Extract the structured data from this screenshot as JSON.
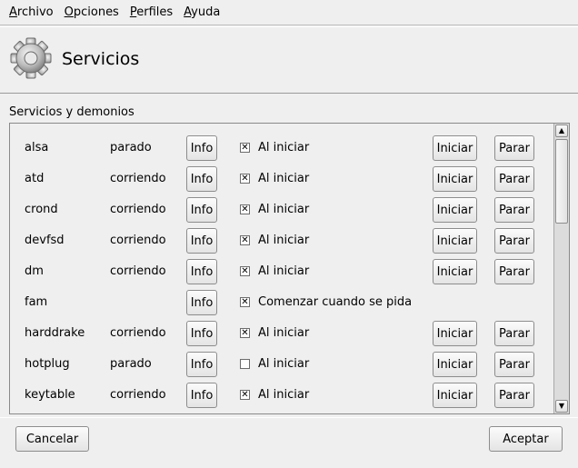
{
  "menubar": {
    "items": [
      {
        "first": "A",
        "rest": "rchivo"
      },
      {
        "first": "O",
        "rest": "pciones"
      },
      {
        "first": "P",
        "rest": "erfiles"
      },
      {
        "first": "A",
        "rest": "yuda"
      }
    ]
  },
  "header": {
    "title": "Servicios",
    "icon": "gear-icon"
  },
  "section_label": "Servicios y demonios",
  "services": [
    {
      "name": "alsa",
      "state": "parado",
      "info": "Info",
      "checked": true,
      "startup": "Al iniciar",
      "start": "Iniciar",
      "stop": "Parar"
    },
    {
      "name": "atd",
      "state": "corriendo",
      "info": "Info",
      "checked": true,
      "startup": "Al iniciar",
      "start": "Iniciar",
      "stop": "Parar"
    },
    {
      "name": "crond",
      "state": "corriendo",
      "info": "Info",
      "checked": true,
      "startup": "Al iniciar",
      "start": "Iniciar",
      "stop": "Parar"
    },
    {
      "name": "devfsd",
      "state": "corriendo",
      "info": "Info",
      "checked": true,
      "startup": "Al iniciar",
      "start": "Iniciar",
      "stop": "Parar"
    },
    {
      "name": "dm",
      "state": "corriendo",
      "info": "Info",
      "checked": true,
      "startup": "Al iniciar",
      "start": "Iniciar",
      "stop": "Parar"
    },
    {
      "name": "fam",
      "state": "",
      "info": "Info",
      "checked": true,
      "startup": "Comenzar cuando se pida",
      "start": "",
      "stop": ""
    },
    {
      "name": "harddrake",
      "state": "corriendo",
      "info": "Info",
      "checked": true,
      "startup": "Al iniciar",
      "start": "Iniciar",
      "stop": "Parar"
    },
    {
      "name": "hotplug",
      "state": "parado",
      "info": "Info",
      "checked": false,
      "startup": "Al iniciar",
      "start": "Iniciar",
      "stop": "Parar"
    },
    {
      "name": "keytable",
      "state": "corriendo",
      "info": "Info",
      "checked": true,
      "startup": "Al iniciar",
      "start": "Iniciar",
      "stop": "Parar"
    }
  ],
  "footer": {
    "cancel": "Cancelar",
    "accept": "Aceptar"
  }
}
